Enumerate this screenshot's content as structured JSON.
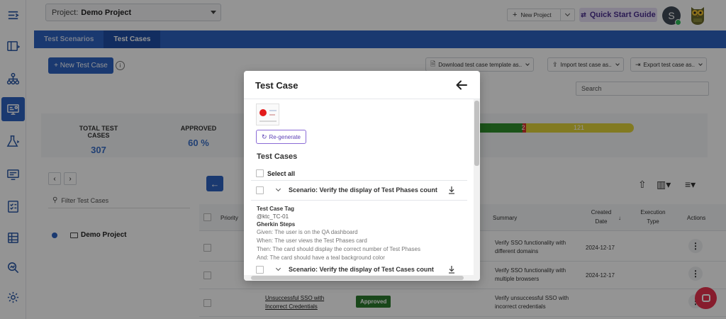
{
  "topbar": {
    "project_label": "Project:",
    "project_value": "Demo Project",
    "new_project": "New Project",
    "quick_start": "Quick Start Guide",
    "avatar_initial": "S"
  },
  "tabs": [
    {
      "label": "Test Scenarios",
      "active": false
    },
    {
      "label": "Test Cases",
      "active": true
    }
  ],
  "toolbar": {
    "new_test_case": "+ New Test Case",
    "download_template": "Download test case template as..",
    "import": "Import test case as..",
    "export": "Export test case as..",
    "search_placeholder": "Search"
  },
  "stats": {
    "total_label": "TOTAL TEST CASES",
    "total_value": "307",
    "approved_label": "APPROVED",
    "approved_value": "60 %",
    "bar": {
      "red_count": "2",
      "yellow_count": "121",
      "green_fraction": 0.37,
      "red_fraction": 0.02
    }
  },
  "left_panel": {
    "filter_placeholder": "Filter Test Cases",
    "tree_root": "Demo Project"
  },
  "table": {
    "headers": {
      "priority": "Priority",
      "summary": "Summary",
      "created": "Created Date",
      "execution": "Execution Type",
      "actions": "Actions"
    },
    "rows": [
      {
        "title": "",
        "status": "",
        "summary": "Verify SSO functionality with different domains",
        "date": "2024-12-17"
      },
      {
        "title": "",
        "status": "",
        "summary": "Verify SSO functionality with multiple browsers",
        "date": "2024-12-17"
      },
      {
        "title": "Unsuccessful SSO with Incorrect Credentials",
        "status": "Approved",
        "summary": "Verify unsuccessful SSO with incorrect credentials",
        "date": "2024-12-17"
      }
    ]
  },
  "modal": {
    "title": "Test Case",
    "regenerate": "Re-generate",
    "section_title": "Test Cases",
    "select_all": "Select all",
    "scenarios": [
      {
        "label": "Scenario: Verify the display of Test Phases count",
        "tag_label": "Test Case Tag",
        "tag_value": "@ktc_TC-01",
        "gherkin_label": "Gherkin Steps",
        "steps": [
          "Given: The user is on the QA dashboard",
          "When: The user views the Test Phases card",
          "Then: The card should display the correct number of Test Phases",
          "And: The card should have a teal background color"
        ]
      },
      {
        "label": "Scenario: Verify the display of Test Cases count"
      }
    ]
  },
  "colors": {
    "primary": "#2d62c2",
    "approved": "#2b7a2e",
    "bar_green": "#2f8f2c",
    "bar_red": "#d9362e",
    "bar_yellow": "#e0d23a",
    "chat": "#e8334f"
  }
}
